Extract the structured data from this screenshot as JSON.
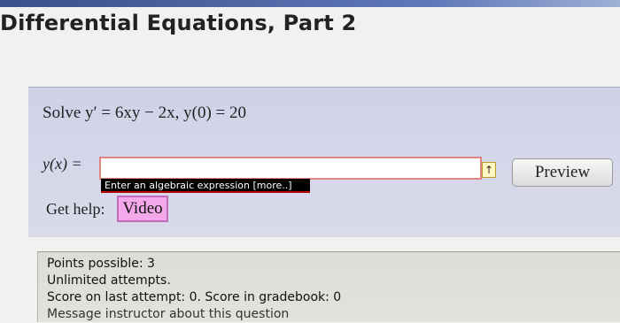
{
  "page": {
    "title": "Differential Equations, Part 2"
  },
  "question": {
    "problem_text": "Solve y′ = 6xy − 2x, y(0) = 20",
    "answer_label": "y(x) =",
    "answer_value": "",
    "hint_text": "Enter an algebraic expression [more..]",
    "arrow_glyph": "↑",
    "preview_label": "Preview",
    "help_label": "Get help:",
    "video_label": "Video"
  },
  "info": {
    "points": "Points possible: 3",
    "attempts": "Unlimited attempts.",
    "score": "Score on last attempt: 0. Score in gradebook: 0",
    "message": "Message instructor about this question"
  },
  "colors": {
    "question_bg": "#d6d8ea",
    "input_border": "#e28484",
    "video_bg": "#f2a8e9",
    "hint_bg": "#000000"
  }
}
